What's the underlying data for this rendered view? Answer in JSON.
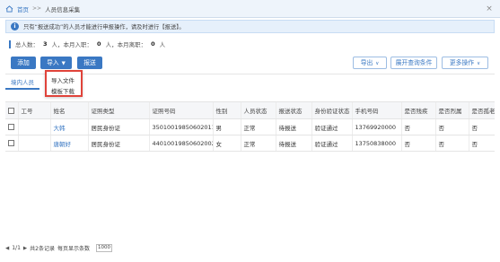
{
  "breadcrumb": {
    "home": "首页",
    "separator": ">>",
    "current": "人员信息采集"
  },
  "notice": {
    "text": "只有“报送成功”的人员才能进行申报操作，请及时进行【报送】。"
  },
  "stats": {
    "total_label": "总人数：",
    "total_value": "3",
    "hired_label": "人，本月入职：",
    "hired_value": "0",
    "left_label": "人，本月离职：",
    "left_value": "0",
    "suffix": "人"
  },
  "toolbar": {
    "add": "添加",
    "import": "导入",
    "submit": "报送",
    "export": "导出",
    "query_conditions": "展开查询条件",
    "more_actions": "更多操作"
  },
  "import_menu": {
    "items": [
      "导入文件",
      "模板下载"
    ]
  },
  "tabs": {
    "domestic": "境内人员"
  },
  "table": {
    "headers": [
      "",
      "工号",
      "姓名",
      "证照类型",
      "证照号码",
      "性别",
      "人员状态",
      "报送状态",
      "身份验证状态",
      "手机号码",
      "是否残疾",
      "是否烈属",
      "是否孤老"
    ],
    "rows": [
      [
        "",
        "",
        "大韩",
        "居民身份证",
        "350100198506020116",
        "男",
        "正常",
        "待报送",
        "验证通过",
        "13769920000",
        "否",
        "否",
        "否"
      ],
      [
        "",
        "",
        "唐朝好",
        "居民身份证",
        "44010019850602002X",
        "女",
        "正常",
        "待报送",
        "验证通过",
        "13750838000",
        "否",
        "否",
        "否"
      ]
    ]
  },
  "pager": {
    "page": "1/1",
    "records": "共2条记录",
    "per_page_label": "每页显示条数",
    "per_page_value": "1000"
  },
  "colors": {
    "accent": "#3a78c3",
    "menu_highlight": "#e0433a"
  }
}
